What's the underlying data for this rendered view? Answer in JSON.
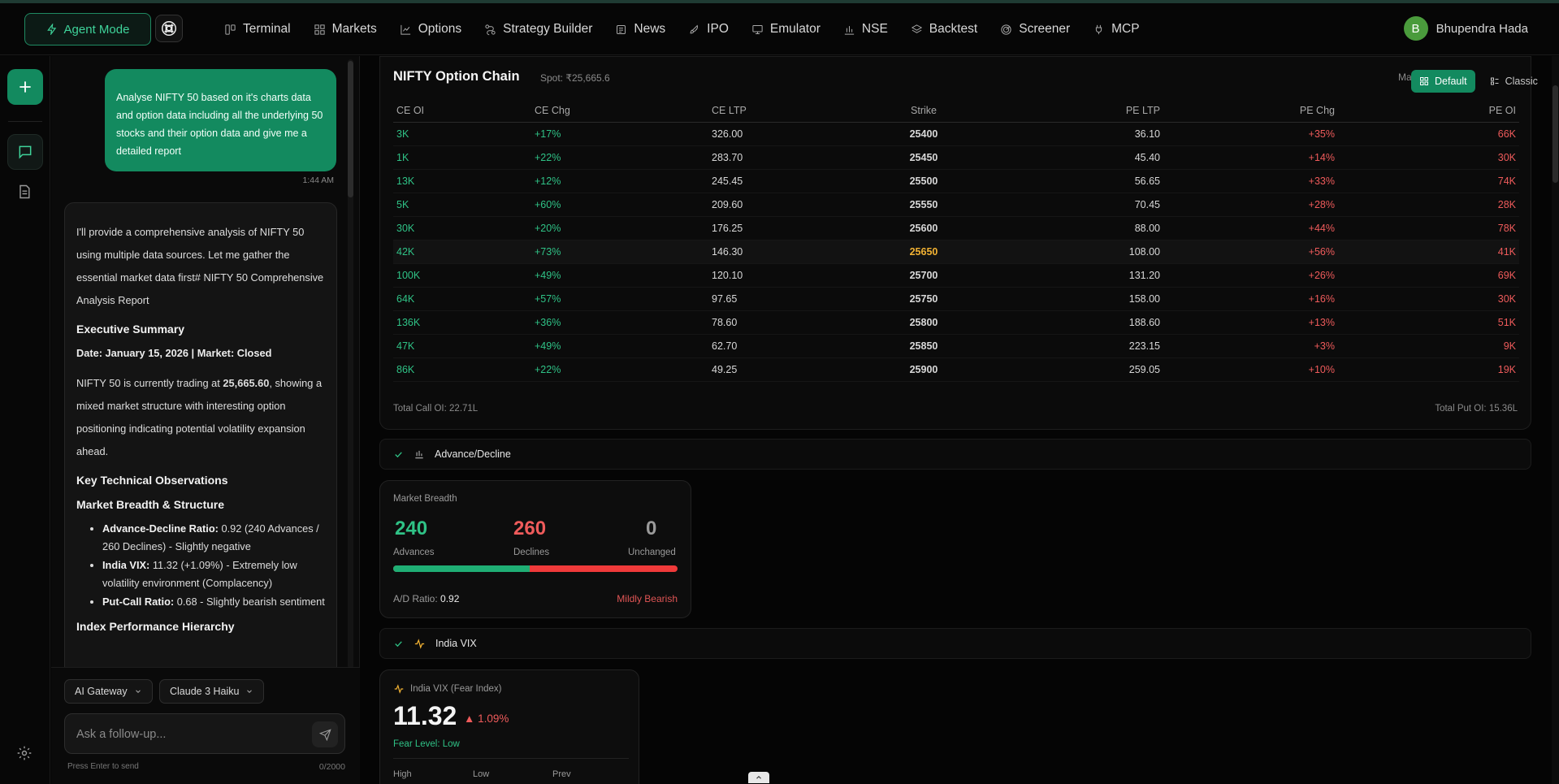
{
  "topbar": {
    "agent_mode": "Agent Mode",
    "nav": [
      {
        "label": "Terminal",
        "icon": "terminal-icon"
      },
      {
        "label": "Markets",
        "icon": "grid-icon"
      },
      {
        "label": "Options",
        "icon": "chart-line-icon"
      },
      {
        "label": "Strategy Builder",
        "icon": "route-icon"
      },
      {
        "label": "News",
        "icon": "newspaper-icon"
      },
      {
        "label": "IPO",
        "icon": "rocket-icon"
      },
      {
        "label": "Emulator",
        "icon": "monitor-icon"
      },
      {
        "label": "NSE",
        "icon": "bar-chart-icon"
      },
      {
        "label": "Backtest",
        "icon": "layers-icon"
      },
      {
        "label": "Screener",
        "icon": "radar-icon"
      },
      {
        "label": "MCP",
        "icon": "plug-icon"
      }
    ],
    "user_initial": "B",
    "user_name": "Bhupendra Hada"
  },
  "chat": {
    "user_message": "Analyse NIFTY 50 based on it's charts data and option data including all the underlying 50 stocks and their option data and give me a detailed report",
    "time": "1:44 AM",
    "ai": {
      "intro": "I'll provide a comprehensive analysis of NIFTY 50 using multiple data sources. Let me gather the essential market data first# NIFTY 50 Comprehensive Analysis Report",
      "h_summary": "Executive Summary",
      "date_line": "Date: January 15, 2026 | Market: Closed",
      "trading_pre": "NIFTY 50 is currently trading at ",
      "trading_value": "25,665.60",
      "trading_post": ", showing a mixed market structure with interesting option positioning indicating potential volatility expansion ahead.",
      "h_key": "Key Technical Observations",
      "h_breadth": "Market Breadth & Structure",
      "bullets": [
        {
          "label": "Advance-Decline Ratio:",
          "text": " 0.92 (240 Advances / 260 Declines) - Slightly negative"
        },
        {
          "label": "India VIX:",
          "text": " 11.32 (+1.09%) - Extremely low volatility environment (Complacency)"
        },
        {
          "label": "Put-Call Ratio:",
          "text": " 0.68 - Slightly bearish sentiment"
        }
      ],
      "h_index": "Index Performance Hierarchy"
    },
    "gateway": "AI Gateway",
    "model": "Claude 3 Haiku",
    "input_placeholder": "Ask a follow-up...",
    "hint": "Press Enter to send",
    "count": "0/2000"
  },
  "option_chain": {
    "title": "NIFTY Option Chain",
    "spot": "Spot: ₹25,665.6",
    "ma_label": "Ma",
    "toggle_default": "Default",
    "toggle_classic": "Classic",
    "headers": [
      "CE OI",
      "CE Chg",
      "CE LTP",
      "Strike",
      "PE LTP",
      "PE Chg",
      "PE OI"
    ],
    "rows": [
      {
        "ce_oi": "3K",
        "ce_chg": "+17%",
        "ce_ltp": "326.00",
        "strike": "25400",
        "pe_ltp": "36.10",
        "pe_chg": "+35%",
        "pe_oi": "66K"
      },
      {
        "ce_oi": "1K",
        "ce_chg": "+22%",
        "ce_ltp": "283.70",
        "strike": "25450",
        "pe_ltp": "45.40",
        "pe_chg": "+14%",
        "pe_oi": "30K"
      },
      {
        "ce_oi": "13K",
        "ce_chg": "+12%",
        "ce_ltp": "245.45",
        "strike": "25500",
        "pe_ltp": "56.65",
        "pe_chg": "+33%",
        "pe_oi": "74K"
      },
      {
        "ce_oi": "5K",
        "ce_chg": "+60%",
        "ce_ltp": "209.60",
        "strike": "25550",
        "pe_ltp": "70.45",
        "pe_chg": "+28%",
        "pe_oi": "28K"
      },
      {
        "ce_oi": "30K",
        "ce_chg": "+20%",
        "ce_ltp": "176.25",
        "strike": "25600",
        "pe_ltp": "88.00",
        "pe_chg": "+44%",
        "pe_oi": "78K"
      },
      {
        "ce_oi": "42K",
        "ce_chg": "+73%",
        "ce_ltp": "146.30",
        "strike": "25650",
        "pe_ltp": "108.00",
        "pe_chg": "+56%",
        "pe_oi": "41K",
        "atm": true
      },
      {
        "ce_oi": "100K",
        "ce_chg": "+49%",
        "ce_ltp": "120.10",
        "strike": "25700",
        "pe_ltp": "131.20",
        "pe_chg": "+26%",
        "pe_oi": "69K"
      },
      {
        "ce_oi": "64K",
        "ce_chg": "+57%",
        "ce_ltp": "97.65",
        "strike": "25750",
        "pe_ltp": "158.00",
        "pe_chg": "+16%",
        "pe_oi": "30K"
      },
      {
        "ce_oi": "136K",
        "ce_chg": "+36%",
        "ce_ltp": "78.60",
        "strike": "25800",
        "pe_ltp": "188.60",
        "pe_chg": "+13%",
        "pe_oi": "51K"
      },
      {
        "ce_oi": "47K",
        "ce_chg": "+49%",
        "ce_ltp": "62.70",
        "strike": "25850",
        "pe_ltp": "223.15",
        "pe_chg": "+3%",
        "pe_oi": "9K"
      },
      {
        "ce_oi": "86K",
        "ce_chg": "+22%",
        "ce_ltp": "49.25",
        "strike": "25900",
        "pe_ltp": "259.05",
        "pe_chg": "+10%",
        "pe_oi": "19K"
      }
    ],
    "total_call": "Total Call OI: 22.71L",
    "total_put": "Total Put OI: 15.36L"
  },
  "advance_decline": {
    "section_label": "Advance/Decline",
    "card_label": "Market Breadth",
    "advances": "240",
    "advances_label": "Advances",
    "declines": "260",
    "declines_label": "Declines",
    "unchanged": "0",
    "unchanged_label": "Unchanged",
    "advance_fraction": 0.48,
    "ratio_label": "A/D Ratio: ",
    "ratio_value": "0.92",
    "mood": "Mildly Bearish"
  },
  "vix": {
    "section_label": "India VIX",
    "card_label": "India VIX (Fear Index)",
    "value": "11.32",
    "change": "▲ 1.09%",
    "fear_level": "Fear Level: Low",
    "stats": [
      "High",
      "Low",
      "Prev"
    ]
  },
  "colors": {
    "accent": "#138a5f",
    "positive": "#2fc286",
    "negative": "#ef5b5b",
    "atm_strike": "#f2b233"
  }
}
